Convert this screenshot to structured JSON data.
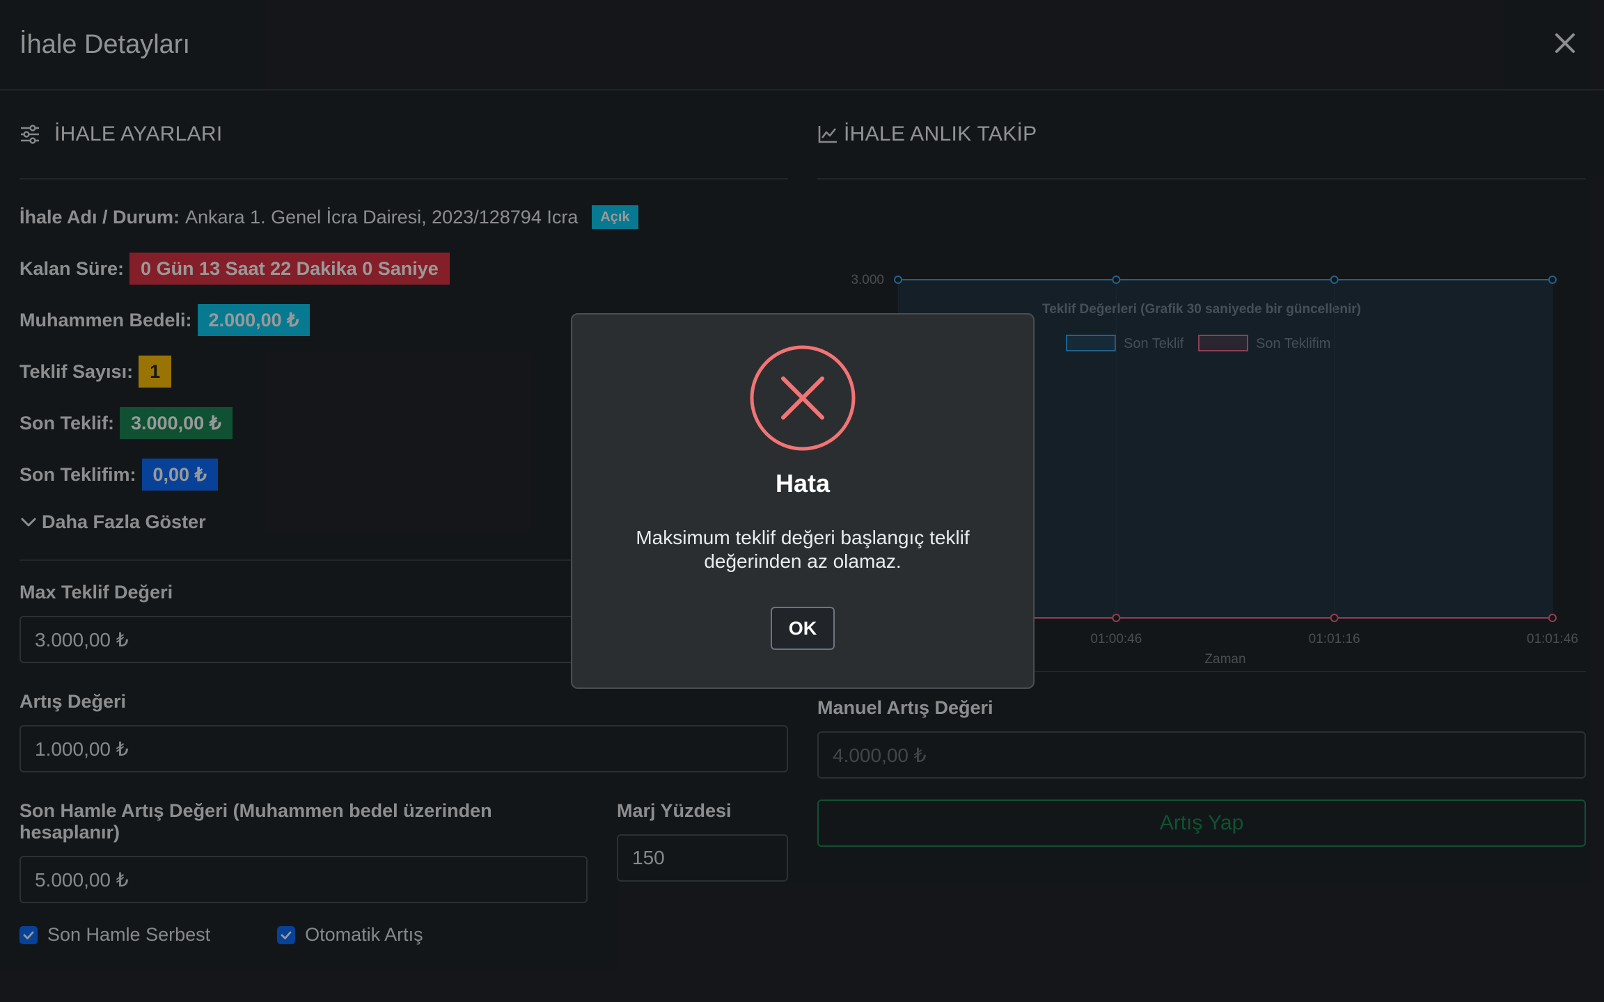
{
  "modal": {
    "title": "İhale Detayları",
    "close_icon": "close-icon"
  },
  "left": {
    "section_title": "İHALE AYARLARI",
    "name_label": "İhale Adı / Durum:",
    "name_value": "Ankara 1. Genel İcra Dairesi, 2023/128794 Icra",
    "status_badge": "Açık",
    "remaining_label": "Kalan Süre:",
    "remaining_value": "0 Gün 13 Saat 22 Dakika 0 Saniye",
    "estimated_label": "Muhammen Bedeli:",
    "estimated_value": "2.000,00 ₺",
    "bid_count_label": "Teklif Sayısı:",
    "bid_count_value": "1",
    "last_bid_label": "Son Teklif:",
    "last_bid_value": "3.000,00 ₺",
    "my_last_bid_label": "Son Teklifim:",
    "my_last_bid_value": "0,00 ₺",
    "show_more": "Daha Fazla Göster",
    "max_bid_label": "Max Teklif Değeri",
    "max_bid_value": "3.000,00 ₺",
    "increment_label": "Artış Değeri",
    "increment_value": "1.000,00 ₺",
    "last_move_label": "Son Hamle Artış Değeri (Muhammen bedel üzerinden hesaplanır)",
    "last_move_value": "5.000,00 ₺",
    "margin_label": "Marj Yüzdesi",
    "margin_value": "150",
    "check1": "Son Hamle Serbest",
    "check2": "Otomatik Artış"
  },
  "right": {
    "section_title": "İHALE ANLIK TAKİP",
    "manual_label": "Manuel Artış Değeri",
    "manual_placeholder": "4.000,00 ₺",
    "submit": "Artış Yap"
  },
  "chart_data": {
    "type": "area",
    "title": "Teklif Değerleri (Grafik 30 saniyede bir güncellenir)",
    "xlabel": "Zaman",
    "ylabel": "",
    "x": [
      "01:00:16",
      "01:00:46",
      "01:01:16",
      "01:01:46"
    ],
    "x_tick_labels": [
      "01:00:46",
      "01:01:16",
      "01:01:46"
    ],
    "y_tick_labels": [
      "3.000"
    ],
    "ylim": [
      0,
      3000
    ],
    "legend_position": "top",
    "series": [
      {
        "name": "Son Teklif",
        "values": [
          3000,
          3000,
          3000,
          3000
        ],
        "color": "#36a2eb"
      },
      {
        "name": "Son Teklifim",
        "values": [
          0,
          0,
          0,
          0
        ],
        "color": "#ff6384"
      }
    ]
  },
  "dialog": {
    "icon": "error-x-icon",
    "title": "Hata",
    "message": "Maksimum teklif değeri başlangıç teklif değerinden az olamaz.",
    "ok": "OK",
    "icon_color": "#f27474"
  }
}
